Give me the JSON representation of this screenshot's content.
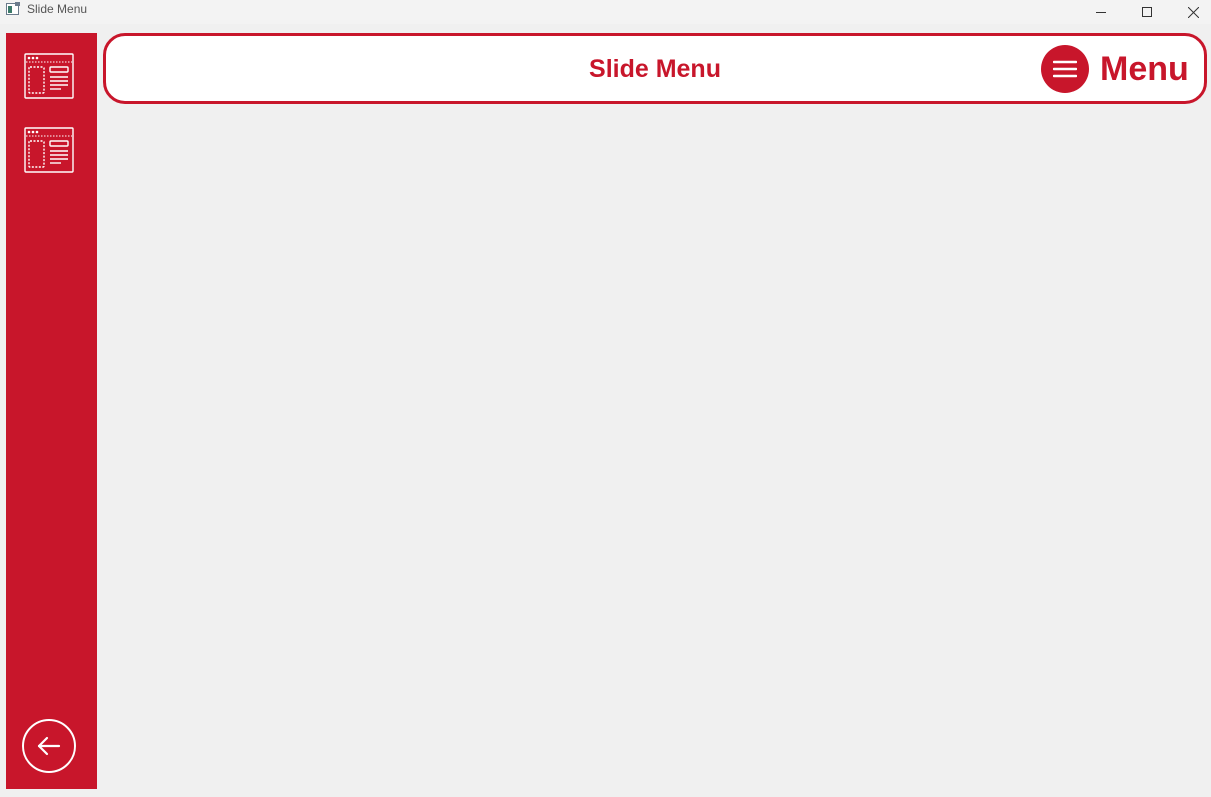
{
  "window": {
    "title": "Slide Menu"
  },
  "header": {
    "title": "Slide Menu",
    "menu_label": "Menu"
  },
  "sidebar": {
    "items": [
      {
        "icon": "layout-panel-icon"
      },
      {
        "icon": "layout-panel-icon"
      }
    ],
    "back_icon": "arrow-left-icon"
  },
  "colors": {
    "accent": "#c8162b",
    "background": "#f0f0f0",
    "header_bg": "#ffffff"
  }
}
